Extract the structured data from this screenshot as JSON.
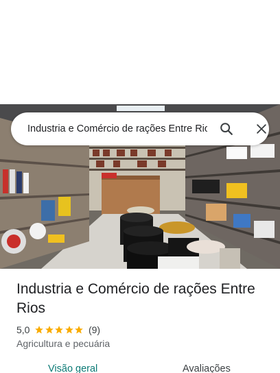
{
  "search": {
    "query": "Industria e Comércio de rações Entre Rios"
  },
  "icons": {
    "search": "search-icon",
    "close": "close-icon",
    "star": "star-icon"
  },
  "place": {
    "name": "Industria e Comércio de rações Entre Rios",
    "rating": "5,0",
    "rating_value": 5,
    "review_count": "(9)",
    "category": "Agricultura e pecuária"
  },
  "tabs": [
    {
      "label": "Visão geral",
      "active": true
    },
    {
      "label": "Avaliações",
      "active": false
    }
  ],
  "colors": {
    "star": "#f9ab00",
    "active_tab": "#0b7a75",
    "text": "#202124",
    "secondary_text": "#5f6368"
  }
}
